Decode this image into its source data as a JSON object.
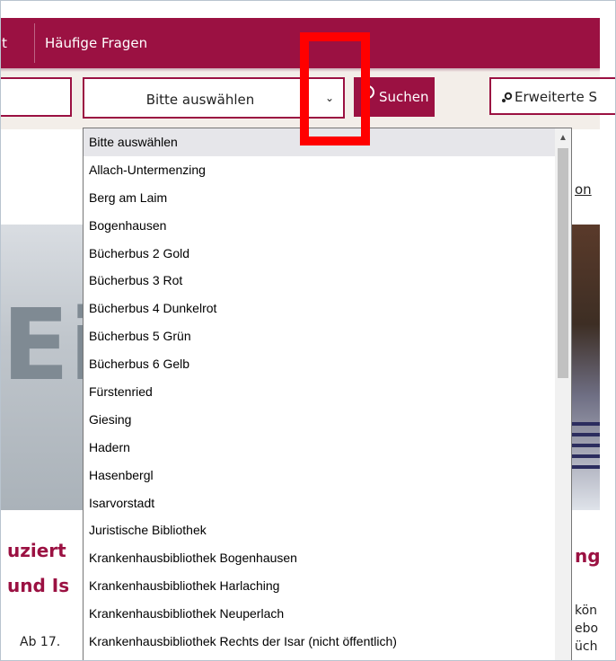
{
  "nav": {
    "items": [
      "t",
      "Häufige Fragen"
    ]
  },
  "search": {
    "select_value": "Bitte auswählen",
    "search_button": "Suchen",
    "advanced_button": "Erweiterte S"
  },
  "page": {
    "side_link": "on",
    "hero_fragment": "Ei",
    "heading_left_1": "uziert",
    "heading_left_2": "und Is",
    "heading_right": "ng",
    "body_left": "Ab 17.",
    "body_right": [
      "kön",
      "ebo",
      "üch"
    ]
  },
  "dropdown": {
    "options": [
      "Bitte auswählen",
      "Allach-Untermenzing",
      "Berg am Laim",
      "Bogenhausen",
      "Bücherbus 2 Gold",
      "Bücherbus 3 Rot",
      "Bücherbus 4 Dunkelrot",
      "Bücherbus 5 Grün",
      "Bücherbus 6 Gelb",
      "Fürstenried",
      "Giesing",
      "Hadern",
      "Hasenbergl",
      "Isarvorstadt",
      "Juristische Bibliothek",
      "Krankenhausbibliothek Bogenhausen",
      "Krankenhausbibliothek Harlaching",
      "Krankenhausbibliothek Neuperlach",
      "Krankenhausbibliothek Rechts der Isar (nicht öffentlich)"
    ],
    "selected_index": 0
  },
  "colors": {
    "brand": "#9b1142",
    "annotation": "#ff0000",
    "selected_option_bg": "#e6e6ea"
  },
  "icons": {
    "search": "search-icon",
    "advanced": "gears-icon",
    "dropdown": "chevron-down-icon",
    "scroll_up": "scroll-up-arrow-icon"
  }
}
